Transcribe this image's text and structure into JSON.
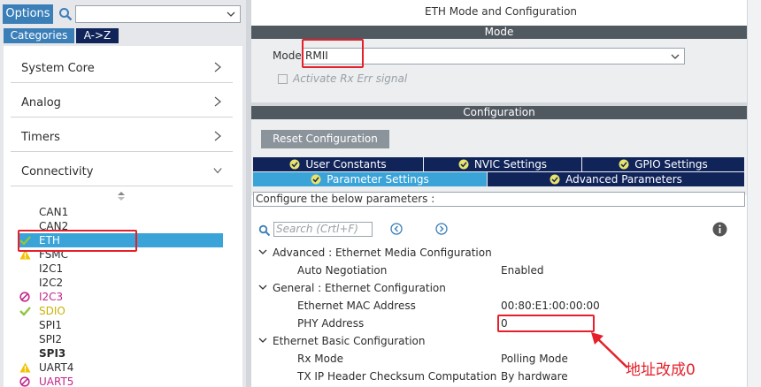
{
  "left": {
    "options_label": "Options",
    "tabs": [
      "Categories",
      "A->Z"
    ],
    "categories": [
      {
        "label": "System Core",
        "expanded": false
      },
      {
        "label": "Analog",
        "expanded": false
      },
      {
        "label": "Timers",
        "expanded": false
      },
      {
        "label": "Connectivity",
        "expanded": true
      }
    ],
    "peripherals": [
      {
        "name": "CAN1",
        "status": "none"
      },
      {
        "name": "CAN2",
        "status": "none"
      },
      {
        "name": "ETH",
        "status": "ok",
        "selected": true
      },
      {
        "name": "FSMC",
        "status": "warning"
      },
      {
        "name": "I2C1",
        "status": "none"
      },
      {
        "name": "I2C2",
        "status": "none"
      },
      {
        "name": "I2C3",
        "status": "disabled"
      },
      {
        "name": "SDIO",
        "status": "ok"
      },
      {
        "name": "SPI1",
        "status": "none"
      },
      {
        "name": "SPI2",
        "status": "none"
      },
      {
        "name": "SPI3",
        "status": "none"
      },
      {
        "name": "UART4",
        "status": "warning"
      },
      {
        "name": "UART5",
        "status": "disabled"
      }
    ]
  },
  "right": {
    "title": "ETH Mode and Configuration",
    "mode_header": "Mode",
    "mode_label": "Mode",
    "mode_value": "RMII",
    "activate_label": "Activate Rx Err signal",
    "config_header": "Configuration",
    "reset_label": "Reset Configuration",
    "tabs_row1": [
      "User Constants",
      "NVIC Settings",
      "GPIO Settings"
    ],
    "tabs_row2": [
      "Parameter Settings",
      "Advanced Parameters"
    ],
    "configure_text": "Configure the below parameters :",
    "search_placeholder": "Search (Crtl+F)",
    "groups": [
      {
        "title": "Advanced : Ethernet Media Configuration",
        "rows": [
          {
            "k": "Auto Negotiation",
            "v": "Enabled"
          }
        ]
      },
      {
        "title": "General : Ethernet Configuration",
        "rows": [
          {
            "k": "Ethernet MAC Address",
            "v": "00:80:E1:00:00:00"
          },
          {
            "k": "PHY Address",
            "v": "0"
          }
        ]
      },
      {
        "title": "Ethernet Basic Configuration",
        "rows": [
          {
            "k": "Rx Mode",
            "v": "Polling Mode"
          },
          {
            "k": "TX IP Header Checksum Computation",
            "v": "By hardware"
          }
        ]
      }
    ],
    "annotation": "地址改成0"
  },
  "colors": {
    "accent": "#3b7fb9",
    "dark_tab": "#10245a",
    "selected": "#3aa3d8",
    "header": "#505860",
    "annotation_red": "#e5202a",
    "ok_green": "#8dc63f",
    "warn_yellow": "#f2c200",
    "disabled_magenta": "#c0288c"
  }
}
